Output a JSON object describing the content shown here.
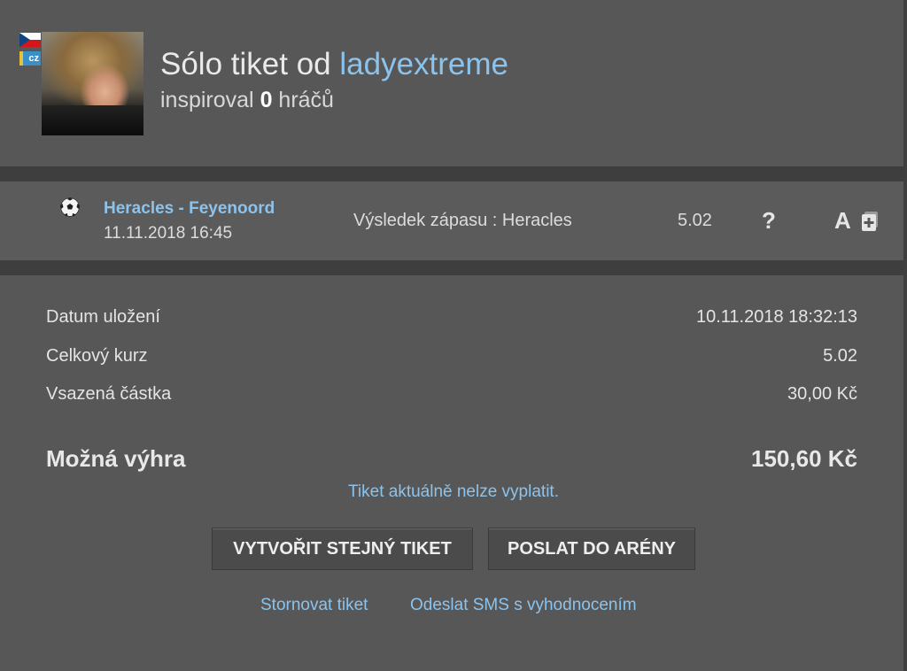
{
  "header": {
    "title_prefix": "Sólo tiket od",
    "username": "ladyextreme",
    "subtitle_prefix": "inspiroval",
    "inspired_count": "0",
    "subtitle_suffix": "hráčů",
    "country_badge": "cz",
    "flag_icon": "czech-flag-icon"
  },
  "bet": {
    "sport_icon": "soccer-ball-icon",
    "match": "Heracles - Feyenoord",
    "datetime": "11.11.2018 16:45",
    "tip": "Výsledek zápasu : Heracles",
    "odds": "5.02",
    "status_icon": "question-icon",
    "status_symbol": "?",
    "analysis_symbol": "A",
    "analysis_icon": "a-icon"
  },
  "summary": {
    "saved_label": "Datum uložení",
    "saved_value": "10.11.2018 18:32:13",
    "total_odds_label": "Celkový kurz",
    "total_odds_value": "5.02",
    "stake_label": "Vsazená částka",
    "stake_value": "30,00 Kč",
    "possible_win_label": "Možná výhra",
    "possible_win_value": "150,60 Kč",
    "notice": "Tiket aktuálně nelze vyplatit."
  },
  "actions": {
    "copy_ticket": "VYTVOŘIT STEJNÝ TIKET",
    "send_arena": "POSLAT DO ARÉNY",
    "cancel_ticket": "Stornovat tiket",
    "send_sms": "Odeslat SMS s vyhodnocením"
  },
  "colors": {
    "background": "#545454",
    "accent_link": "#8cc3ec",
    "separator": "#3e3e3e",
    "button": "#4b4b4b"
  }
}
